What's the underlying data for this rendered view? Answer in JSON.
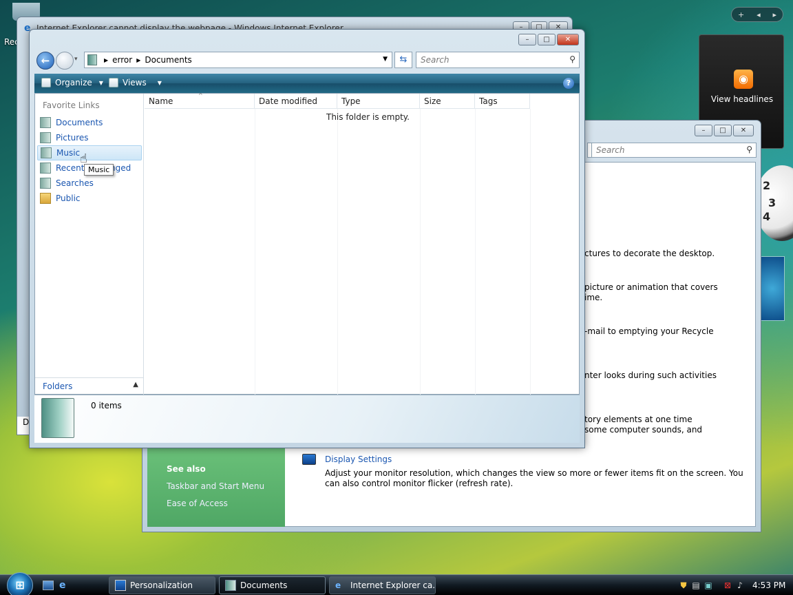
{
  "desktop": {
    "recycle_label": "Rec",
    "feed_gadget_label": "View headlines",
    "feed_icon_name": "rss-feed-icon",
    "clock_numbers": [
      "2",
      "3",
      "4"
    ],
    "sidebar_controls": [
      "+",
      "◂",
      "▸"
    ]
  },
  "ie_window": {
    "title": "Internet Explorer cannot display the webpage - Windows Internet Explorer",
    "body_letter": "D"
  },
  "personalization_window": {
    "search_placeholder": "Search",
    "see_also": {
      "heading": "See also",
      "links": [
        "Taskbar and Start Menu",
        "Ease of Access"
      ]
    },
    "descriptions": [
      "ctures to decorate the desktop.",
      "picture or animation that covers",
      "ime.",
      "-mail to emptying your Recycle",
      "nter looks during such activities",
      "tory elements at one time",
      "some computer sounds, and"
    ],
    "display_settings": {
      "link": "Display Settings",
      "desc_line1": "Adjust your monitor resolution, which changes the view so more or fewer items fit on the screen. You",
      "desc_line2": "can also control monitor flicker (refresh rate)."
    }
  },
  "documents_window": {
    "breadcrumb": [
      "error",
      "Documents"
    ],
    "search_placeholder": "Search",
    "toolbar": {
      "organize_label": "Organize",
      "views_label": "Views"
    },
    "favorite_links": {
      "heading": "Favorite Links",
      "items": [
        {
          "label": "Documents",
          "icon": "documents-folder-icon"
        },
        {
          "label": "Pictures",
          "icon": "pictures-folder-icon"
        },
        {
          "label": "Music",
          "icon": "music-folder-icon"
        },
        {
          "label": "Recently Changed",
          "icon": "recent-folder-icon"
        },
        {
          "label": "Searches",
          "icon": "searches-folder-icon"
        },
        {
          "label": "Public",
          "icon": "public-folder-icon"
        }
      ],
      "selected": "Music"
    },
    "folders_label": "Folders",
    "columns": [
      "Name",
      "Date modified",
      "Type",
      "Size",
      "Tags"
    ],
    "empty_message": "This folder is empty.",
    "details": {
      "item_count": "0 items"
    },
    "tooltip": "Music"
  },
  "taskbar": {
    "buttons": [
      {
        "label": "Personalization",
        "active": false
      },
      {
        "label": "Documents",
        "active": true
      },
      {
        "label": "Internet Explorer ca...",
        "active": false
      }
    ],
    "clock": "4:53 PM"
  }
}
